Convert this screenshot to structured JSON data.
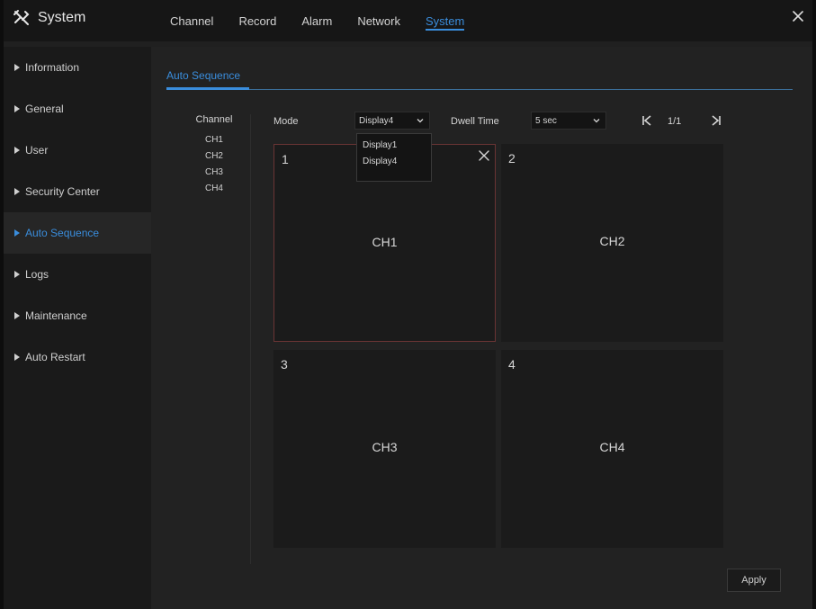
{
  "app": {
    "title": "System"
  },
  "tabs": [
    {
      "label": "Channel"
    },
    {
      "label": "Record"
    },
    {
      "label": "Alarm"
    },
    {
      "label": "Network"
    },
    {
      "label": "System",
      "active": true
    }
  ],
  "sidebar": {
    "items": [
      {
        "label": "Information"
      },
      {
        "label": "General"
      },
      {
        "label": "User"
      },
      {
        "label": "Security Center"
      },
      {
        "label": "Auto Sequence",
        "active": true
      },
      {
        "label": "Logs"
      },
      {
        "label": "Maintenance"
      },
      {
        "label": "Auto Restart"
      }
    ]
  },
  "section": {
    "tab": "Auto Sequence"
  },
  "channel_list": {
    "header": "Channel",
    "items": [
      "CH1",
      "CH2",
      "CH3",
      "CH4"
    ]
  },
  "controls": {
    "mode_label": "Mode",
    "mode_value": "Display4",
    "mode_options": [
      "Display1",
      "Display4"
    ],
    "dwell_label": "Dwell Time",
    "dwell_value": "5 sec",
    "page_indicator": "1/1"
  },
  "grid": [
    {
      "number": "1",
      "channel": "CH1",
      "selected": true
    },
    {
      "number": "2",
      "channel": "CH2"
    },
    {
      "number": "3",
      "channel": "CH3"
    },
    {
      "number": "4",
      "channel": "CH4"
    }
  ],
  "apply_label": "Apply",
  "colors": {
    "accent": "#3a8ddc",
    "selected_border": "#6a3434"
  },
  "icons": {
    "title": "tools-icon",
    "close": "close-icon",
    "first_page": "first-page-icon",
    "last_page": "last-page-icon",
    "dropdown": "chevron-down-icon",
    "cell_close": "close-icon"
  }
}
